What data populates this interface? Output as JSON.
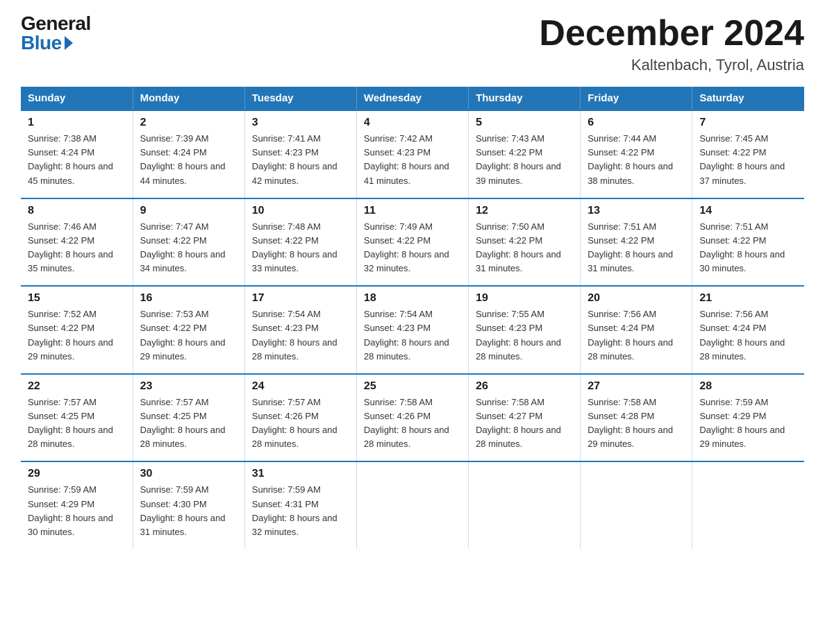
{
  "header": {
    "logo_general": "General",
    "logo_blue": "Blue",
    "month_title": "December 2024",
    "location": "Kaltenbach, Tyrol, Austria"
  },
  "days_of_week": [
    "Sunday",
    "Monday",
    "Tuesday",
    "Wednesday",
    "Thursday",
    "Friday",
    "Saturday"
  ],
  "weeks": [
    [
      {
        "day": "1",
        "sunrise": "7:38 AM",
        "sunset": "4:24 PM",
        "daylight": "8 hours and 45 minutes."
      },
      {
        "day": "2",
        "sunrise": "7:39 AM",
        "sunset": "4:24 PM",
        "daylight": "8 hours and 44 minutes."
      },
      {
        "day": "3",
        "sunrise": "7:41 AM",
        "sunset": "4:23 PM",
        "daylight": "8 hours and 42 minutes."
      },
      {
        "day": "4",
        "sunrise": "7:42 AM",
        "sunset": "4:23 PM",
        "daylight": "8 hours and 41 minutes."
      },
      {
        "day": "5",
        "sunrise": "7:43 AM",
        "sunset": "4:22 PM",
        "daylight": "8 hours and 39 minutes."
      },
      {
        "day": "6",
        "sunrise": "7:44 AM",
        "sunset": "4:22 PM",
        "daylight": "8 hours and 38 minutes."
      },
      {
        "day": "7",
        "sunrise": "7:45 AM",
        "sunset": "4:22 PM",
        "daylight": "8 hours and 37 minutes."
      }
    ],
    [
      {
        "day": "8",
        "sunrise": "7:46 AM",
        "sunset": "4:22 PM",
        "daylight": "8 hours and 35 minutes."
      },
      {
        "day": "9",
        "sunrise": "7:47 AM",
        "sunset": "4:22 PM",
        "daylight": "8 hours and 34 minutes."
      },
      {
        "day": "10",
        "sunrise": "7:48 AM",
        "sunset": "4:22 PM",
        "daylight": "8 hours and 33 minutes."
      },
      {
        "day": "11",
        "sunrise": "7:49 AM",
        "sunset": "4:22 PM",
        "daylight": "8 hours and 32 minutes."
      },
      {
        "day": "12",
        "sunrise": "7:50 AM",
        "sunset": "4:22 PM",
        "daylight": "8 hours and 31 minutes."
      },
      {
        "day": "13",
        "sunrise": "7:51 AM",
        "sunset": "4:22 PM",
        "daylight": "8 hours and 31 minutes."
      },
      {
        "day": "14",
        "sunrise": "7:51 AM",
        "sunset": "4:22 PM",
        "daylight": "8 hours and 30 minutes."
      }
    ],
    [
      {
        "day": "15",
        "sunrise": "7:52 AM",
        "sunset": "4:22 PM",
        "daylight": "8 hours and 29 minutes."
      },
      {
        "day": "16",
        "sunrise": "7:53 AM",
        "sunset": "4:22 PM",
        "daylight": "8 hours and 29 minutes."
      },
      {
        "day": "17",
        "sunrise": "7:54 AM",
        "sunset": "4:23 PM",
        "daylight": "8 hours and 28 minutes."
      },
      {
        "day": "18",
        "sunrise": "7:54 AM",
        "sunset": "4:23 PM",
        "daylight": "8 hours and 28 minutes."
      },
      {
        "day": "19",
        "sunrise": "7:55 AM",
        "sunset": "4:23 PM",
        "daylight": "8 hours and 28 minutes."
      },
      {
        "day": "20",
        "sunrise": "7:56 AM",
        "sunset": "4:24 PM",
        "daylight": "8 hours and 28 minutes."
      },
      {
        "day": "21",
        "sunrise": "7:56 AM",
        "sunset": "4:24 PM",
        "daylight": "8 hours and 28 minutes."
      }
    ],
    [
      {
        "day": "22",
        "sunrise": "7:57 AM",
        "sunset": "4:25 PM",
        "daylight": "8 hours and 28 minutes."
      },
      {
        "day": "23",
        "sunrise": "7:57 AM",
        "sunset": "4:25 PM",
        "daylight": "8 hours and 28 minutes."
      },
      {
        "day": "24",
        "sunrise": "7:57 AM",
        "sunset": "4:26 PM",
        "daylight": "8 hours and 28 minutes."
      },
      {
        "day": "25",
        "sunrise": "7:58 AM",
        "sunset": "4:26 PM",
        "daylight": "8 hours and 28 minutes."
      },
      {
        "day": "26",
        "sunrise": "7:58 AM",
        "sunset": "4:27 PM",
        "daylight": "8 hours and 28 minutes."
      },
      {
        "day": "27",
        "sunrise": "7:58 AM",
        "sunset": "4:28 PM",
        "daylight": "8 hours and 29 minutes."
      },
      {
        "day": "28",
        "sunrise": "7:59 AM",
        "sunset": "4:29 PM",
        "daylight": "8 hours and 29 minutes."
      }
    ],
    [
      {
        "day": "29",
        "sunrise": "7:59 AM",
        "sunset": "4:29 PM",
        "daylight": "8 hours and 30 minutes."
      },
      {
        "day": "30",
        "sunrise": "7:59 AM",
        "sunset": "4:30 PM",
        "daylight": "8 hours and 31 minutes."
      },
      {
        "day": "31",
        "sunrise": "7:59 AM",
        "sunset": "4:31 PM",
        "daylight": "8 hours and 32 minutes."
      },
      null,
      null,
      null,
      null
    ]
  ],
  "labels": {
    "sunrise": "Sunrise:",
    "sunset": "Sunset:",
    "daylight": "Daylight:"
  }
}
